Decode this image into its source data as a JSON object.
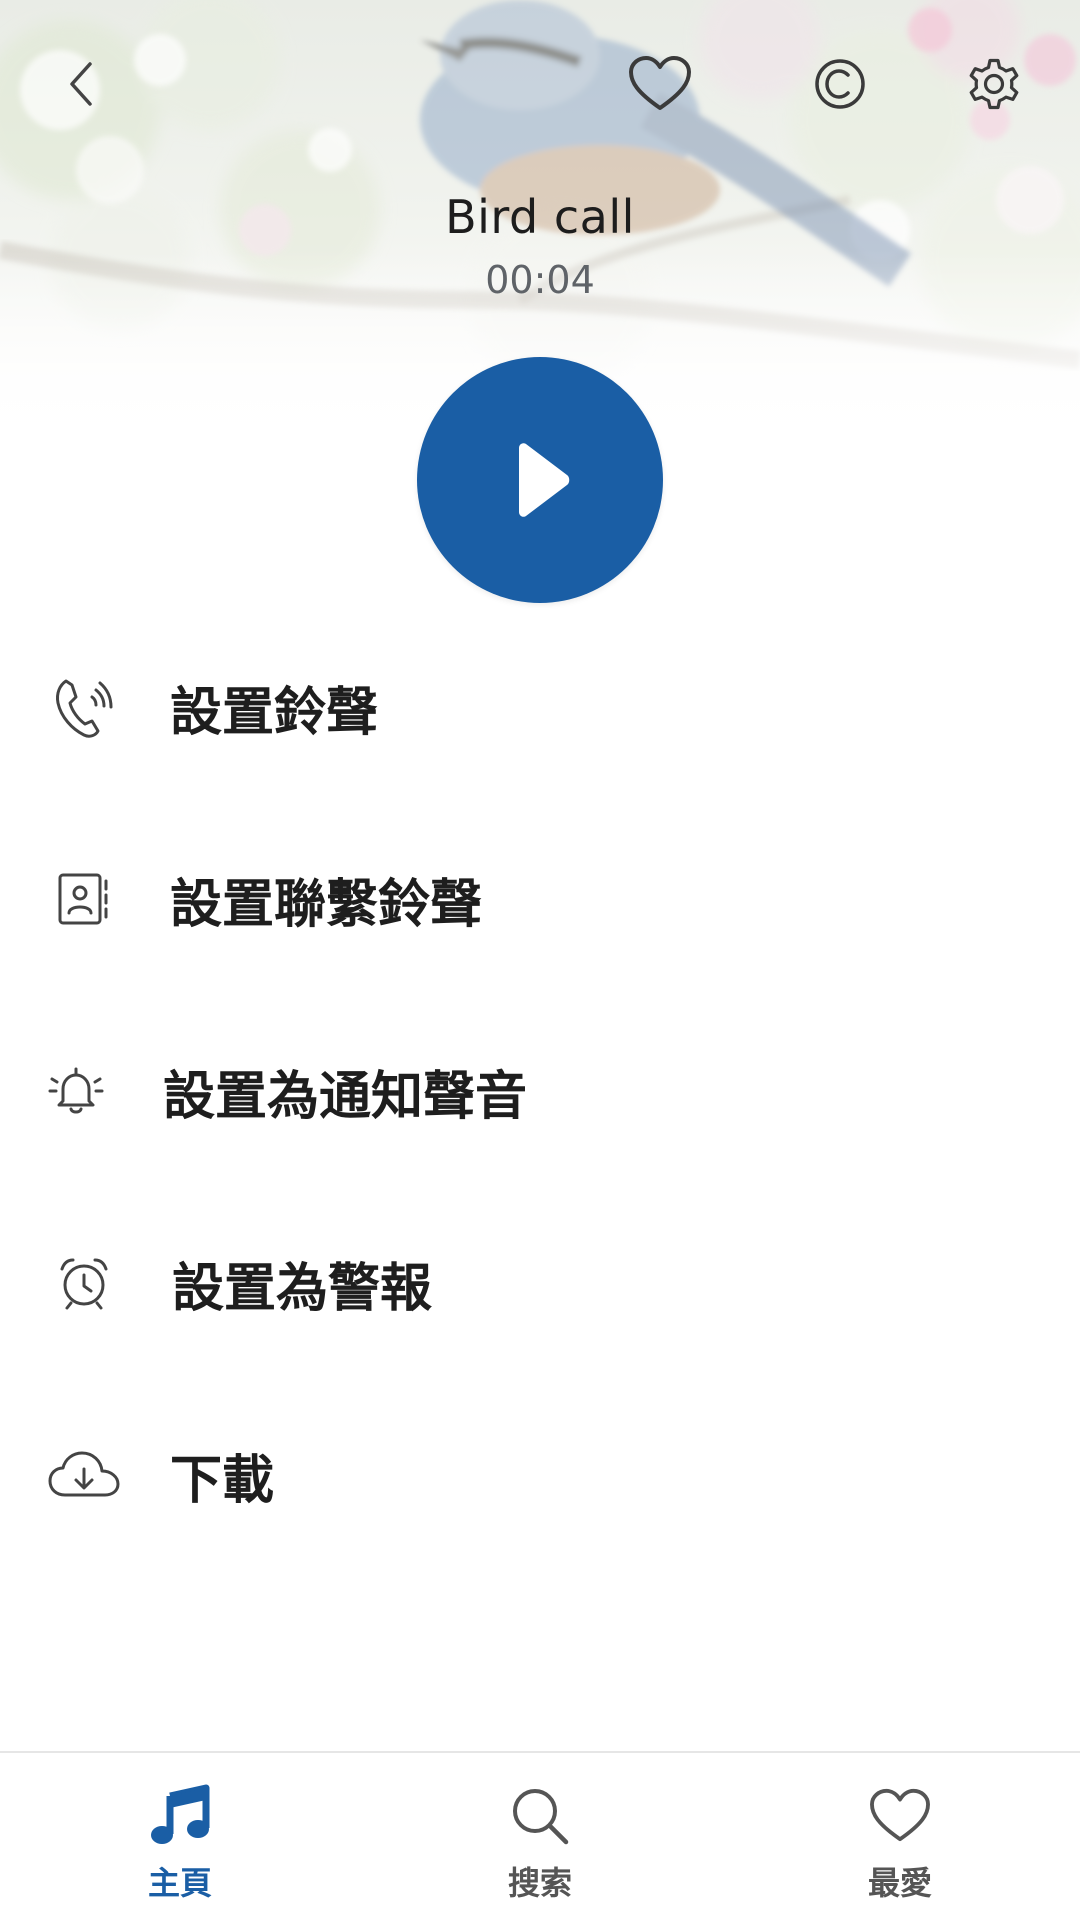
{
  "header": {
    "back_icon": "chevron-left-icon",
    "favorite_icon": "heart-outline-icon",
    "copyright_icon": "copyright-icon",
    "settings_icon": "gear-icon"
  },
  "track": {
    "title": "Bird call",
    "duration": "00:04"
  },
  "player": {
    "play_icon": "play-icon",
    "accent_color": "#1a5ea5"
  },
  "menu": {
    "items": [
      {
        "icon": "phone-ringing-icon",
        "label": "設置鈴聲"
      },
      {
        "icon": "contact-card-icon",
        "label": "設置聯繫鈴聲"
      },
      {
        "icon": "bell-icon",
        "label": "設置為通知聲音"
      },
      {
        "icon": "alarm-clock-icon",
        "label": "設置為警報"
      },
      {
        "icon": "cloud-download-icon",
        "label": "下載"
      }
    ]
  },
  "bottom_nav": {
    "items": [
      {
        "icon": "music-note-icon",
        "label": "主頁",
        "active": true
      },
      {
        "icon": "search-icon",
        "label": "搜索",
        "active": false
      },
      {
        "icon": "heart-outline-icon",
        "label": "最愛",
        "active": false
      }
    ]
  }
}
